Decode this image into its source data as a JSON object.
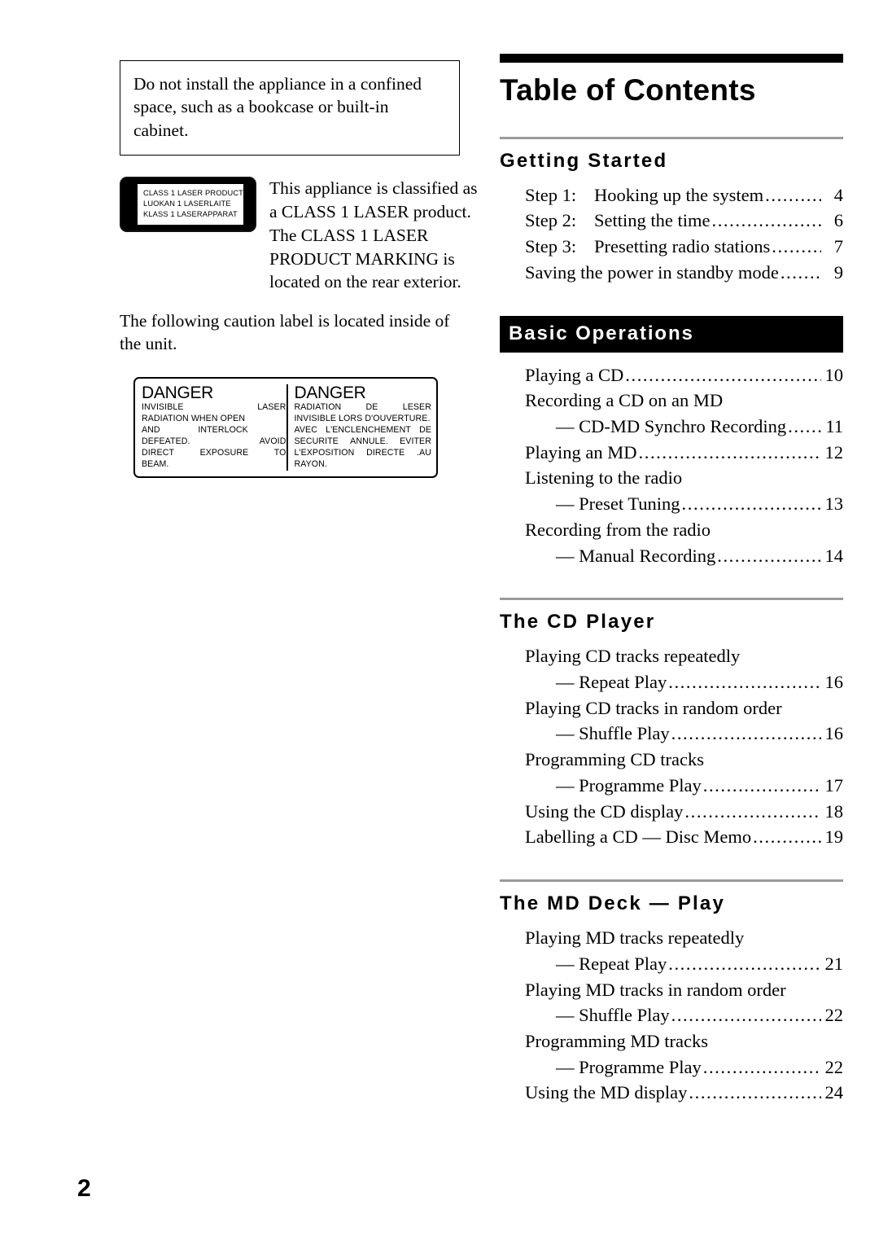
{
  "page": {
    "number": "2"
  },
  "left": {
    "notice": "Do not install the appliance in a confined space, such as a bookcase or built-in cabinet.",
    "laser_label": {
      "line1": "CLASS 1 LASER PRODUCT",
      "line2": "LUOKAN 1 LASERLAITE",
      "line3": "KLASS 1 LASERAPPARAT"
    },
    "laser_text": [
      "This appliance is classified as",
      "a CLASS 1 LASER product.",
      "The CLASS 1 LASER",
      "PRODUCT MARKING is",
      "located on the rear exterior."
    ],
    "caution_intro": "The following caution label is located inside of the unit.",
    "danger_left": {
      "heading": "DANGER",
      "lines": [
        "INVISIBLE    LASER",
        "RADIATION WHEN OPEN",
        "AND    INTERLOCK",
        "DEFEATED.        AVOID",
        "DIRECT  EXPOSURE  TO",
        "BEAM."
      ]
    },
    "danger_right": {
      "heading": "DANGER",
      "lines": [
        "RADIATION    DE    LESER",
        "INVISIBLE LORS D'OUVERTURE.",
        "AVEC  L'ENCLENCHEMENT  DE",
        "SECURITE   ANNULE.   EVITER",
        "L'EXPOSITION   DIRECTE   .AU",
        "RAYON."
      ]
    }
  },
  "toc": {
    "title": "Table of Contents",
    "sections": [
      {
        "heading": "Getting Started",
        "style": "rule",
        "entries": [
          {
            "kind": "leader",
            "prefix": "Step 1:",
            "label": "Hooking up the system",
            "page": "4"
          },
          {
            "kind": "leader",
            "prefix": "Step 2:",
            "label": "Setting the time",
            "page": "6"
          },
          {
            "kind": "leader",
            "prefix": "Step 3:",
            "label": "Presetting radio stations",
            "page": "7"
          },
          {
            "kind": "leader",
            "prefix": "",
            "label": "Saving the power in standby mode",
            "page": "9"
          }
        ]
      },
      {
        "heading": "Basic Operations",
        "style": "banner",
        "entries": [
          {
            "kind": "leader",
            "prefix": "",
            "label": "Playing a CD",
            "page": "10"
          },
          {
            "kind": "plain",
            "label": "Recording a CD on an MD"
          },
          {
            "kind": "sub",
            "label": "— CD-MD Synchro Recording",
            "page": "11"
          },
          {
            "kind": "leader",
            "prefix": "",
            "label": "Playing an MD",
            "page": "12"
          },
          {
            "kind": "plain",
            "label": "Listening to the radio"
          },
          {
            "kind": "sub",
            "label": "— Preset Tuning",
            "page": "13"
          },
          {
            "kind": "plain",
            "label": "Recording from the radio"
          },
          {
            "kind": "sub",
            "label": "— Manual Recording",
            "page": "14"
          }
        ]
      },
      {
        "heading": "The CD Player",
        "style": "rule",
        "entries": [
          {
            "kind": "plain",
            "label": "Playing CD tracks repeatedly"
          },
          {
            "kind": "sub",
            "label": "— Repeat Play",
            "page": "16"
          },
          {
            "kind": "plain",
            "label": "Playing CD tracks in random order"
          },
          {
            "kind": "sub",
            "label": "— Shuffle Play",
            "page": "16"
          },
          {
            "kind": "plain",
            "label": "Programming CD tracks"
          },
          {
            "kind": "sub",
            "label": "— Programme Play",
            "page": "17"
          },
          {
            "kind": "leader",
            "prefix": "",
            "label": "Using the CD display",
            "page": "18"
          },
          {
            "kind": "leader",
            "prefix": "",
            "label": "Labelling a CD — Disc Memo",
            "page": "19"
          }
        ]
      },
      {
        "heading": "The MD Deck — Play",
        "style": "rule",
        "entries": [
          {
            "kind": "plain",
            "label": "Playing MD tracks repeatedly"
          },
          {
            "kind": "sub",
            "label": "— Repeat Play",
            "page": "21"
          },
          {
            "kind": "plain",
            "label": "Playing MD tracks in random order"
          },
          {
            "kind": "sub",
            "label": "— Shuffle Play",
            "page": "22"
          },
          {
            "kind": "plain",
            "label": "Programming MD tracks"
          },
          {
            "kind": "sub",
            "label": "— Programme Play",
            "page": "22"
          },
          {
            "kind": "leader",
            "prefix": "",
            "label": "Using the MD display",
            "page": "24"
          }
        ]
      }
    ]
  },
  "colors": {
    "ink": "#000000",
    "rule_gray": "#9b9b9b",
    "banner_bg": "#000000",
    "banner_fg": "#ffffff"
  }
}
